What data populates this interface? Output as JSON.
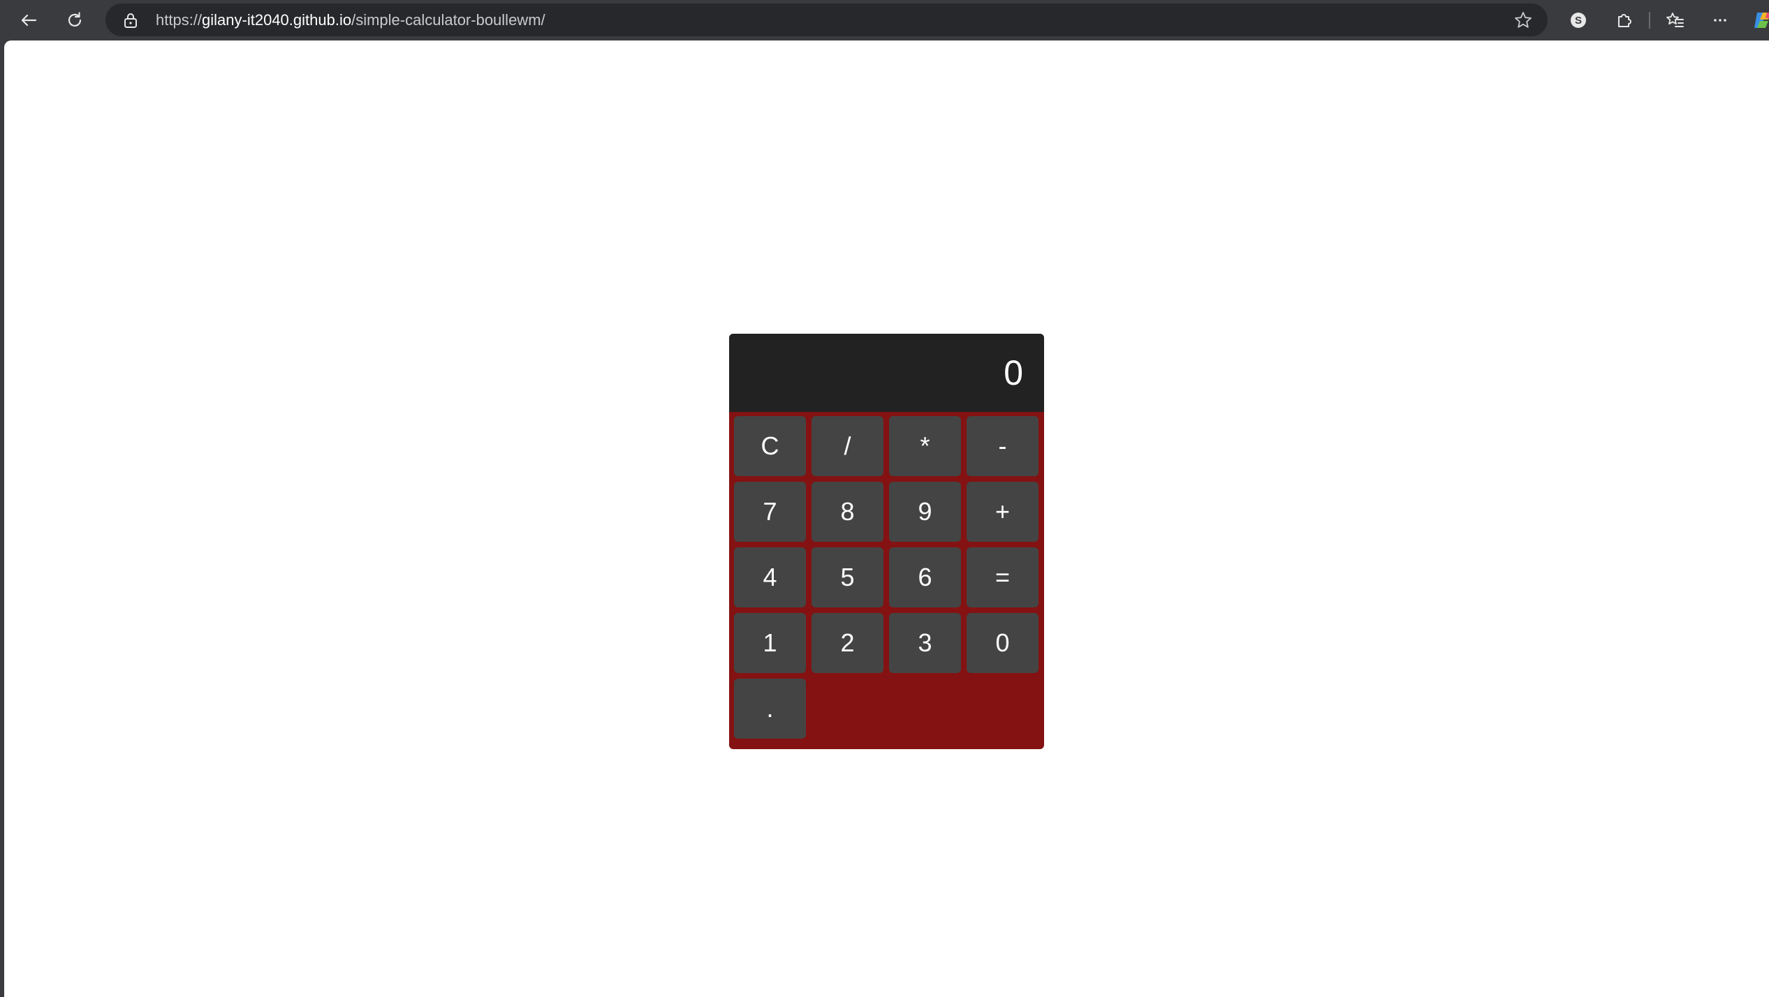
{
  "browser": {
    "url_prefix": "https://",
    "url_host": "gilany-it2040.github.io",
    "url_path": "/simple-calculator-boullewm/",
    "icons": [
      "back-icon",
      "refresh-icon",
      "lock-icon",
      "star-icon",
      "s-profile-icon",
      "extensions-icon",
      "favorites-icon",
      "more-icon",
      "copilot-icon"
    ]
  },
  "calculator": {
    "display_value": "0",
    "keys": [
      "C",
      "/",
      "*",
      "-",
      "7",
      "8",
      "9",
      "+",
      "4",
      "5",
      "6",
      "=",
      "1",
      "2",
      "3",
      "0",
      "."
    ],
    "colors": {
      "body": "#841212",
      "display": "#222222",
      "key": "#444444",
      "text": "#ffffff"
    }
  }
}
